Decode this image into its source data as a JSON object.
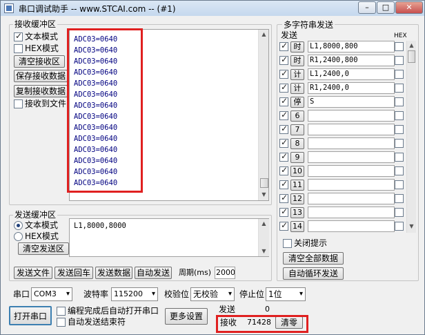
{
  "window": {
    "title": "串口调试助手 -- www.STCAI.com -- (#1)",
    "minimize": "–",
    "maximize": "□",
    "close": "✕"
  },
  "receive": {
    "group_label": "接收缓冲区",
    "text_mode": "文本模式",
    "hex_mode": "HEX模式",
    "clear_btn": "清空接收区",
    "save_btn": "保存接收数据",
    "copy_btn": "复制接收数据",
    "to_file": "接收到文件",
    "lines": [
      "ADC03=0640",
      "ADC03=0640",
      "ADC03=0640",
      "ADC03=0640",
      "ADC03=0640",
      "ADC03=0640",
      "ADC03=0640",
      "ADC03=0640",
      "ADC03=0640",
      "ADC03=0640",
      "ADC03=0640",
      "ADC03=0640",
      "ADC03=0640",
      "ADC03=0640"
    ]
  },
  "send": {
    "group_label": "发送缓冲区",
    "text_mode": "文本模式",
    "hex_mode": "HEX模式",
    "clear_btn": "清空发送区",
    "content": "L1,8000,8000",
    "btn_file": "发送文件",
    "btn_return": "发送回车",
    "btn_data": "发送数据",
    "btn_auto": "自动发送",
    "period_label": "周期(ms)",
    "period_value": "2000"
  },
  "multi": {
    "group_label": "多字符串发送",
    "col_send": "发送",
    "col_hex": "HEX",
    "rows": [
      {
        "label": "时",
        "value": "L1,8000,800",
        "checked": true
      },
      {
        "label": "时",
        "value": "R1,2400,800",
        "checked": true
      },
      {
        "label": "计",
        "value": "L1,2400,0",
        "checked": true
      },
      {
        "label": "计",
        "value": "R1,2400,0",
        "checked": true
      },
      {
        "label": "停",
        "value": "S",
        "checked": true
      },
      {
        "label": "6",
        "value": "",
        "checked": true
      },
      {
        "label": "7",
        "value": "",
        "checked": true
      },
      {
        "label": "8",
        "value": "",
        "checked": true
      },
      {
        "label": "9",
        "value": "",
        "checked": true
      },
      {
        "label": "10",
        "value": "",
        "checked": true
      },
      {
        "label": "11",
        "value": "",
        "checked": true
      },
      {
        "label": "12",
        "value": "",
        "checked": true
      },
      {
        "label": "13",
        "value": "",
        "checked": true
      },
      {
        "label": "14",
        "value": "",
        "checked": true
      }
    ],
    "close_tip": "关闭提示",
    "clear_all": "清空全部数据",
    "auto_loop": "自动循环发送"
  },
  "port": {
    "port_label": "串口",
    "port_value": "COM3",
    "baud_label": "波特率",
    "baud_value": "115200",
    "parity_label": "校验位",
    "parity_value": "无校验",
    "stop_label": "停止位",
    "stop_value": "1位",
    "open_btn": "打开串口",
    "auto_open": "编程完成后自动打开串口",
    "auto_stop": "自动发送结束符",
    "more_btn": "更多设置",
    "sent_label": "发送",
    "sent_count": "0",
    "recv_label": "接收",
    "recv_count": "71428",
    "clear_count": "清零"
  },
  "colors": {
    "highlight": "#e02020",
    "rx_text": "#000080"
  }
}
